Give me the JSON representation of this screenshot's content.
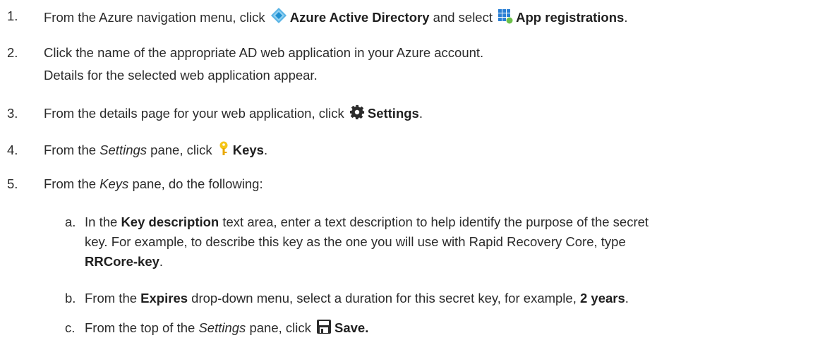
{
  "steps": [
    {
      "num": "1.",
      "t1": "From the Azure navigation menu, click",
      "b1": "Azure Active Directory",
      "t2": "and select",
      "b2": "App registrations",
      "t3": "."
    },
    {
      "num": "2.",
      "line1": "Click the name of the appropriate AD web application in your Azure account.",
      "line2": "Details for the selected web application appear."
    },
    {
      "num": "3.",
      "t1": "From the details page for your web application, click",
      "b1": "Settings",
      "t2": "."
    },
    {
      "num": "4.",
      "t1": "From the",
      "i1": "Settings",
      "t2": "pane, click",
      "b1": "Keys",
      "t3": "."
    },
    {
      "num": "5.",
      "t1": "From the",
      "i1": "Keys",
      "t2": "pane, do the following:"
    }
  ],
  "substeps": [
    {
      "num": "a.",
      "t1": "In the",
      "b1": "Key description",
      "t2": "text area, enter a text description to help identify the purpose of the secret",
      "line2": "key. For example, to describe this key as the one you will use with Rapid Recovery Core, type",
      "b2": "RRCore-key",
      "t3": "."
    },
    {
      "num": "b.",
      "t1": "From the",
      "b1": "Expires",
      "t2": "drop-down menu, select a duration for this secret key, for example,",
      "b2": "2 years",
      "t3": "."
    },
    {
      "num": "c.",
      "t1": "From the top of the",
      "i1": "Settings",
      "t2": "pane, click",
      "b1": "Save."
    }
  ],
  "icons": [
    "azure-ad-icon",
    "app-registrations-icon",
    "gear-icon",
    "key-icon",
    "save-icon"
  ]
}
